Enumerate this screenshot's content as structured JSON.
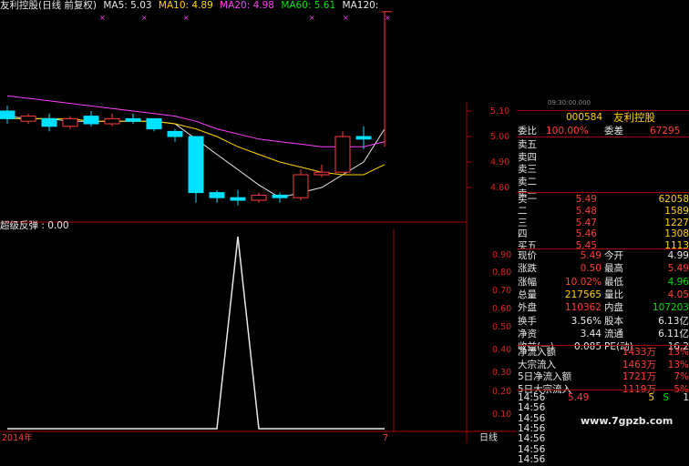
{
  "ma_bar": {
    "title": "友利控股(日线 前复权)",
    "ma5": "MA5: 5.03",
    "ma10": "MA10: 4.89",
    "ma20": "MA20: 4.98",
    "ma60": "MA60: 5.61",
    "ma120": "MA120:"
  },
  "indicator": {
    "label": "超级反弹 : 0.00"
  },
  "bottom": {
    "year": "2014年",
    "month": "7",
    "period": "日线"
  },
  "top_axis": [
    "5.10",
    "5.00",
    "4.90",
    "4.80"
  ],
  "lower_axis": [
    "0.90",
    "0.80",
    "0.70",
    "0.60",
    "0.50",
    "0.40",
    "0.30",
    "0.20",
    "0.10"
  ],
  "upper_axis_top": "",
  "header_time": "09:30:00.000",
  "quote": {
    "code": "000584",
    "name": "友利控股",
    "weibi_label": "委比",
    "weibi_value": "100.00%",
    "weicha_label": "委差",
    "weicha_value": "67295",
    "sell": [
      {
        "label": "卖五",
        "price": "",
        "vol": ""
      },
      {
        "label": "卖四",
        "price": "",
        "vol": ""
      },
      {
        "label": "卖三",
        "price": "",
        "vol": ""
      },
      {
        "label": "卖二",
        "price": "",
        "vol": ""
      },
      {
        "label": "卖一",
        "price": "",
        "vol": ""
      }
    ],
    "buy": [
      {
        "label": "买一",
        "price": "5.49",
        "vol": "62058"
      },
      {
        "label": "二",
        "price": "5.48",
        "vol": "1589"
      },
      {
        "label": "三",
        "price": "5.47",
        "vol": "1227"
      },
      {
        "label": "四",
        "price": "5.46",
        "vol": "1308"
      },
      {
        "label": "买五",
        "price": "5.45",
        "vol": "1113"
      }
    ],
    "stats": [
      {
        "l1": "现价",
        "v1": "5.49",
        "l2": "今开",
        "v2": "4.99",
        "c1": "red",
        "c2": "wht"
      },
      {
        "l1": "涨跌",
        "v1": "0.50",
        "l2": "最高",
        "v2": "5.49",
        "c1": "red",
        "c2": "red"
      },
      {
        "l1": "涨幅",
        "v1": "10.02%",
        "l2": "最低",
        "v2": "4.96",
        "c1": "red",
        "c2": "green"
      },
      {
        "l1": "总量",
        "v1": "217565",
        "l2": "量比",
        "v2": "4.05",
        "c1": "yel",
        "c2": "red"
      },
      {
        "l1": "外盘",
        "v1": "110362",
        "l2": "内盘",
        "v2": "107203",
        "c1": "red",
        "c2": "green"
      },
      {
        "l1": "换手",
        "v1": "3.56%",
        "l2": "股本",
        "v2": "6.13亿",
        "c1": "wht",
        "c2": "wht"
      },
      {
        "l1": "净资",
        "v1": "3.44",
        "l2": "流通",
        "v2": "6.11亿",
        "c1": "wht",
        "c2": "wht"
      },
      {
        "l1": "收益(一)",
        "v1": "0.085",
        "l2": "PE(动)",
        "v2": "16.2",
        "c1": "wht",
        "c2": "wht"
      }
    ],
    "flows": [
      {
        "label": "净流入额",
        "value": "1433万",
        "pct": "13%"
      },
      {
        "label": "大宗流入",
        "value": "1463万",
        "pct": "13%"
      },
      {
        "label": "5日净流入额",
        "value": "1721万",
        "pct": "7%"
      },
      {
        "label": "5日大宗流入",
        "value": "1119万",
        "pct": "5%"
      }
    ],
    "ticks": [
      {
        "time": "14:56",
        "price": "5.49",
        "vol": "5",
        "side": "S",
        "extra": "1"
      },
      {
        "time": "14:56"
      },
      {
        "time": "14:56"
      },
      {
        "time": "14:56"
      },
      {
        "time": "14:56"
      },
      {
        "time": "14:56"
      },
      {
        "time": "14:56"
      }
    ],
    "watermark": "www.7gpzb.com"
  },
  "colors": {
    "up": "#ff3b3b",
    "down": "#00e0ff",
    "ma5": "#e8e8e8",
    "ma10": "#ffd200",
    "ma20": "#ff40ff",
    "ma60": "#00e000"
  },
  "chart_data": {
    "type": "candlestick",
    "candles": [
      {
        "o": 5.1,
        "c": 5.07,
        "h": 5.12,
        "l": 5.05
      },
      {
        "o": 5.06,
        "c": 5.08,
        "h": 5.09,
        "l": 5.05
      },
      {
        "o": 5.07,
        "c": 5.04,
        "h": 5.09,
        "l": 5.02
      },
      {
        "o": 5.04,
        "c": 5.07,
        "h": 5.08,
        "l": 5.03
      },
      {
        "o": 5.08,
        "c": 5.05,
        "h": 5.1,
        "l": 5.04
      },
      {
        "o": 5.05,
        "c": 5.07,
        "h": 5.09,
        "l": 5.04
      },
      {
        "o": 5.07,
        "c": 5.06,
        "h": 5.09,
        "l": 5.05
      },
      {
        "o": 5.07,
        "c": 5.03,
        "h": 5.07,
        "l": 5.02
      },
      {
        "o": 5.02,
        "c": 5.0,
        "h": 5.03,
        "l": 4.98
      },
      {
        "o": 5.0,
        "c": 4.78,
        "h": 5.0,
        "l": 4.74
      },
      {
        "o": 4.78,
        "c": 4.76,
        "h": 4.79,
        "l": 4.74
      },
      {
        "o": 4.76,
        "c": 4.75,
        "h": 4.79,
        "l": 4.73
      },
      {
        "o": 4.75,
        "c": 4.77,
        "h": 4.78,
        "l": 4.74
      },
      {
        "o": 4.77,
        "c": 4.76,
        "h": 4.78,
        "l": 4.74
      },
      {
        "o": 4.76,
        "c": 4.85,
        "h": 4.87,
        "l": 4.75
      },
      {
        "o": 4.85,
        "c": 4.86,
        "h": 4.89,
        "l": 4.84
      },
      {
        "o": 4.86,
        "c": 5.0,
        "h": 5.02,
        "l": 4.86
      },
      {
        "o": 5.0,
        "c": 4.99,
        "h": 5.04,
        "l": 4.95
      },
      {
        "o": 4.99,
        "c": 5.49,
        "h": 5.49,
        "l": 4.96
      }
    ],
    "ma_lines": [
      {
        "name": "MA5",
        "color": "#e8e8e8",
        "values": [
          5.08,
          5.07,
          5.07,
          5.06,
          5.06,
          5.06,
          5.06,
          5.06,
          5.05,
          4.99,
          4.93,
          4.87,
          4.81,
          4.76,
          4.78,
          4.8,
          4.85,
          4.9,
          5.03
        ]
      },
      {
        "name": "MA10",
        "color": "#ffd200",
        "values": [
          5.07,
          5.07,
          5.07,
          5.07,
          5.06,
          5.06,
          5.06,
          5.06,
          5.05,
          5.03,
          5.0,
          4.96,
          4.93,
          4.9,
          4.88,
          4.86,
          4.85,
          4.85,
          4.89
        ]
      },
      {
        "name": "MA20",
        "color": "#ff40ff",
        "values": [
          5.16,
          5.15,
          5.14,
          5.13,
          5.12,
          5.11,
          5.1,
          5.09,
          5.08,
          5.06,
          5.03,
          5.01,
          4.99,
          4.98,
          4.97,
          4.96,
          4.96,
          4.96,
          4.98
        ]
      }
    ],
    "indicator": {
      "name": "超级反弹",
      "values": [
        0,
        0,
        0,
        0,
        0,
        0,
        0,
        0,
        0,
        0,
        0,
        1,
        0,
        0,
        0,
        0,
        0,
        0,
        0
      ]
    }
  }
}
